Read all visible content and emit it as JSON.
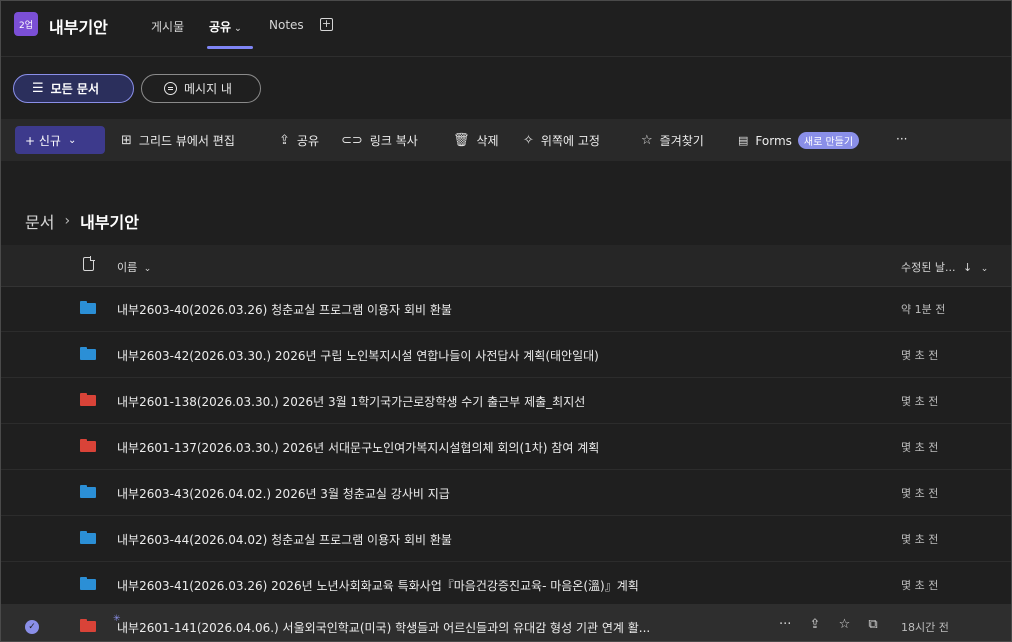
{
  "header": {
    "team_badge": "2업",
    "title": "내부기안",
    "tabs": [
      {
        "label": "게시물"
      },
      {
        "label": "공유"
      },
      {
        "label": "Notes"
      }
    ]
  },
  "pills": {
    "all_docs": "모든 문서",
    "messages": "메시지 내"
  },
  "commands": {
    "new": "+ 신규",
    "grid_edit": "그리드 뷰에서 편집",
    "share": "공유",
    "copy_link": "링크 복사",
    "delete": "삭제",
    "pin_top": "위쪽에 고정",
    "favorite": "즐겨찾기",
    "forms": "Forms",
    "forms_new": "새로 만들기",
    "more": "···"
  },
  "breadcrumb": {
    "root": "문서",
    "current": "내부기안"
  },
  "table": {
    "col_name": "이름",
    "col_modified": "수정된 날...",
    "rows": [
      {
        "name": "내부2603-40(2026.03.26) 청춘교실 프로그램 이용자 회비 환불",
        "modified": "약 1분 전",
        "folder_color": "#2b8fd6"
      },
      {
        "name": "내부2603-42(2026.03.30.) 2026년 구립 노인복지시설 연합나들이 사전답사 계획(태안일대)",
        "modified": "몇 초 전",
        "folder_color": "#2b8fd6"
      },
      {
        "name": "내부2601-138(2026.03.30.) 2026년 3월 1학기국가근로장학생 수기 출근부 제출_최지선",
        "modified": "몇 초 전",
        "folder_color": "#d94338"
      },
      {
        "name": "내부2601-137(2026.03.30.) 2026년 서대문구노인여가복지시설협의체 회의(1차) 참여 계획",
        "modified": "몇 초 전",
        "folder_color": "#d94338"
      },
      {
        "name": "내부2603-43(2026.04.02.) 2026년 3월 청춘교실 강사비 지급",
        "modified": "몇 초 전",
        "folder_color": "#2b8fd6"
      },
      {
        "name": "내부2603-44(2026.04.02) 청춘교실 프로그램 이용자 회비 환불",
        "modified": "몇 초 전",
        "folder_color": "#2b8fd6"
      },
      {
        "name": "내부2603-41(2026.03.26) 2026년 노년사회화교육 특화사업『마음건강증진교육- 마음온(溫)』계획",
        "modified": "몇 초 전",
        "folder_color": "#2b8fd6"
      },
      {
        "name": "내부2601-141(2026.04.06.) 서울외국인학교(미국) 학생들과 어르신들과의 유대감 형성 기관 연계 활...",
        "modified": "18시간 전",
        "folder_color": "#d94338"
      }
    ]
  },
  "colors": {
    "accent": "#7f85f5",
    "background": "#1f1f1f"
  }
}
